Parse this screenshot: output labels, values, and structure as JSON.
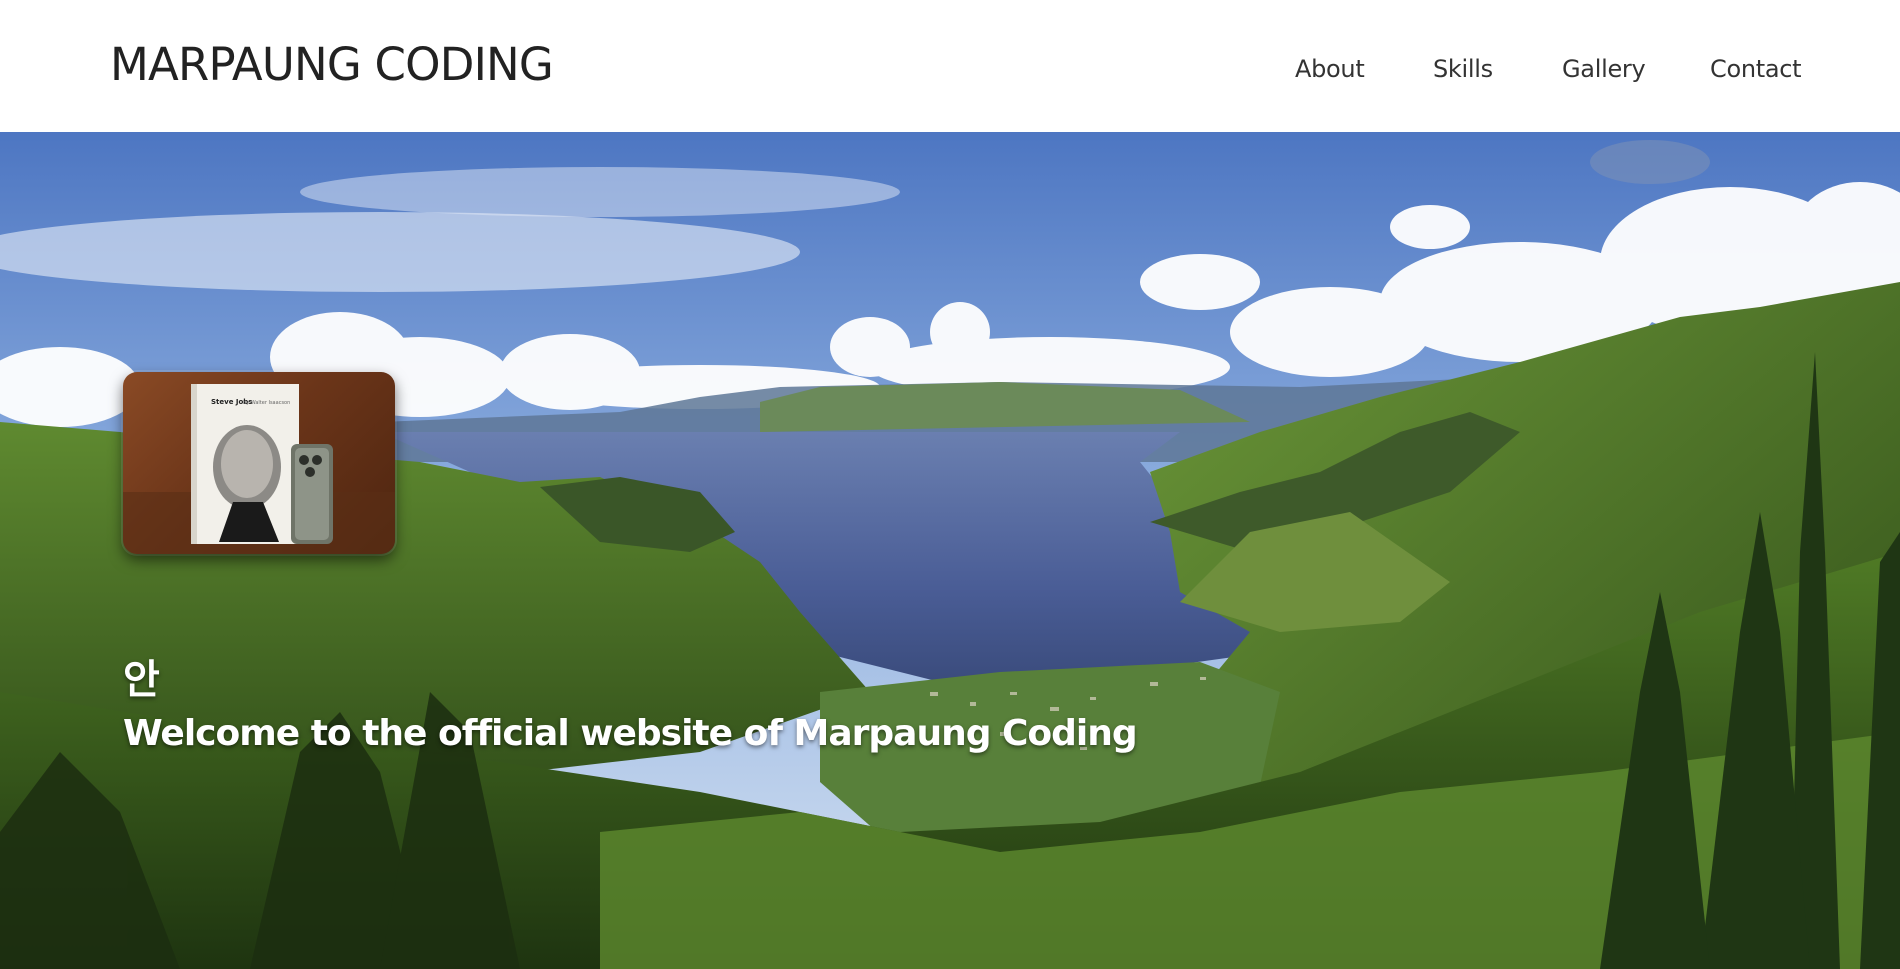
{
  "header": {
    "brand": "MARPAUNG CODING",
    "nav": [
      "About",
      "Skills",
      "Gallery",
      "Contact"
    ]
  },
  "hero": {
    "greeting": "안",
    "tagline": "Welcome to the official website of Marpaung Coding",
    "photo": {
      "book_title": "Steve Jobs",
      "book_author": "by Walter Isaacson"
    }
  },
  "colors": {
    "header_bg": "#ffffff",
    "brand_text": "#222222",
    "nav_text": "#333333",
    "hero_text": "#ffffff"
  }
}
